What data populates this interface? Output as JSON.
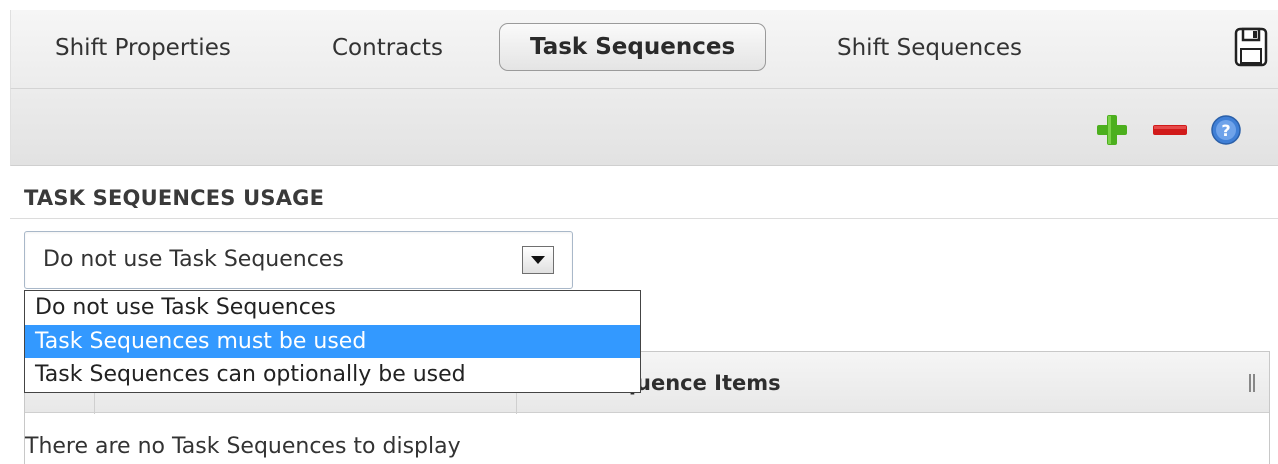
{
  "tabs": [
    {
      "label": "Shift Properties",
      "active": false
    },
    {
      "label": "Contracts",
      "active": false
    },
    {
      "label": "Task Sequences",
      "active": true
    },
    {
      "label": "Shift Sequences",
      "active": false
    }
  ],
  "toolbar": {
    "icons": [
      "save-icon",
      "add-icon",
      "remove-icon",
      "help-icon"
    ],
    "colors": {
      "add": "#4caf1e",
      "remove": "#d11a1a",
      "help": "#3f7fd6"
    }
  },
  "section": {
    "title": "TASK SEQUENCES USAGE"
  },
  "usage_select": {
    "value": "Do not use Task Sequences",
    "options": [
      "Do not use Task Sequences",
      "Task Sequences must be used",
      "Task Sequences can optionally be used"
    ],
    "highlighted_index": 1
  },
  "grid": {
    "visible_header_fragment": "quence Items",
    "empty_message": "There are no Task Sequences to display"
  },
  "colors": {
    "highlight": "#3399ff"
  }
}
